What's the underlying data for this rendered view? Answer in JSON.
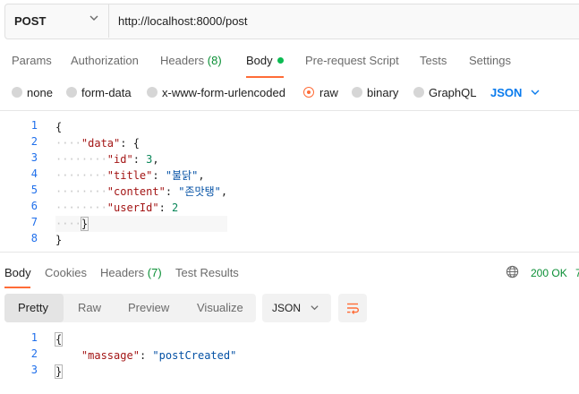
{
  "request": {
    "method": "POST",
    "url": "http://localhost:8000/post"
  },
  "request_tabs": {
    "params": "Params",
    "authorization": "Authorization",
    "headers": "Headers",
    "headers_count": "(8)",
    "body": "Body",
    "pre_request": "Pre-request Script",
    "tests": "Tests",
    "settings": "Settings"
  },
  "body_types": {
    "none": "none",
    "form_data": "form-data",
    "urlencoded": "x-www-form-urlencoded",
    "raw": "raw",
    "binary": "binary",
    "graphql": "GraphQL",
    "language": "JSON"
  },
  "request_body": {
    "line_numbers": [
      "1",
      "2",
      "3",
      "4",
      "5",
      "6",
      "7",
      "8"
    ],
    "open_brace": "{",
    "data_key": "\"data\"",
    "id_key": "\"id\"",
    "id_value": "3",
    "title_key": "\"title\"",
    "title_value": "\"불닭\"",
    "content_key": "\"content\"",
    "content_value": "\"존맛탱\"",
    "userid_key": "\"userId\"",
    "userid_value": "2",
    "close_inner": "}",
    "close_brace": "}"
  },
  "response_tabs": {
    "body": "Body",
    "cookies": "Cookies",
    "headers": "Headers",
    "headers_count": "(7)",
    "test_results": "Test Results",
    "status": "200 OK",
    "status_next": "7"
  },
  "response_view": {
    "pretty": "Pretty",
    "raw": "Raw",
    "preview": "Preview",
    "visualize": "Visualize",
    "format": "JSON"
  },
  "response_body": {
    "line_numbers": [
      "1",
      "2",
      "3"
    ],
    "open_brace": "{",
    "massage_key": "\"massage\"",
    "massage_value": "\"postCreated\"",
    "close_brace": "}"
  },
  "colors": {
    "accent": "#ff6c37",
    "link_blue": "#097bed",
    "success_green": "#0a8f35"
  }
}
